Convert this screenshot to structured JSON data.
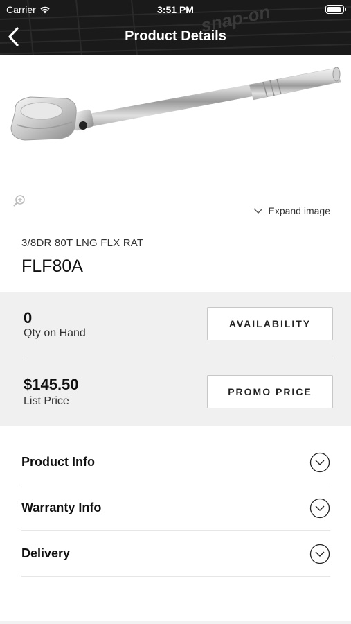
{
  "status_bar": {
    "carrier": "Carrier",
    "time": "3:51 PM",
    "battery_level": 0.95
  },
  "nav": {
    "title": "Product Details",
    "back_icon": "chevron-left-icon"
  },
  "product": {
    "image_alt": "ratchet-image",
    "expand_label": "Expand image",
    "description": "3/8DR 80T LNG FLX RAT",
    "sku": "FLF80A"
  },
  "stock": {
    "qty_value": "0",
    "qty_label": "Qty on Hand",
    "availability_button": "AVAILABILITY",
    "price_value": "$145.50",
    "price_label": "List Price",
    "promo_button": "PROMO PRICE"
  },
  "accordion": [
    {
      "label": "Product Info",
      "icon": "chevron-down-circle-icon"
    },
    {
      "label": "Warranty Info",
      "icon": "chevron-down-circle-icon"
    },
    {
      "label": "Delivery",
      "icon": "chevron-down-circle-icon"
    }
  ],
  "colors": {
    "header_bg": "#111111",
    "panel_bg": "#f0f0f0",
    "text": "#111111"
  }
}
